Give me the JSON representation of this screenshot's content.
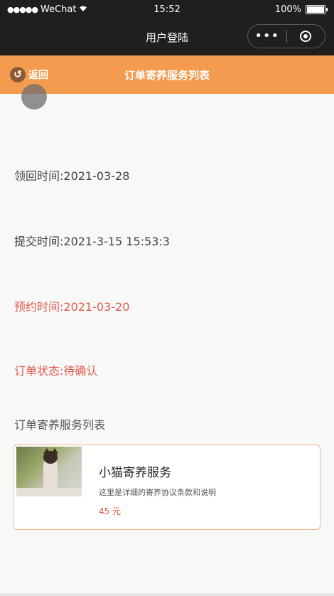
{
  "status_bar": {
    "carrier": "WeChat",
    "signal_dots": "●●●●●",
    "time": "15:52",
    "battery": "100%"
  },
  "nav_bar": {
    "title": "用户登陆",
    "more_glyph": "•••"
  },
  "page_header": {
    "back_label": "返回",
    "title": "订单寄养服务列表"
  },
  "order": {
    "pickup_time": "领回时间:2021-03-28",
    "submit_time": "提交时间:2021-3-15 15:53:3",
    "appointment_time": "预约时间:2021-03-20",
    "status": "订单状态:待确认"
  },
  "section": {
    "label": "订单寄养服务列表"
  },
  "services": [
    {
      "name": "小猫寄养服务",
      "description": "这里是详细的寄养协议条款和说明",
      "price": "45 元"
    }
  ],
  "colors": {
    "header": "#f59b4f",
    "status_red": "#e05c4c",
    "top_bar": "#1f1f1f",
    "card_border": "#f2b98f"
  }
}
